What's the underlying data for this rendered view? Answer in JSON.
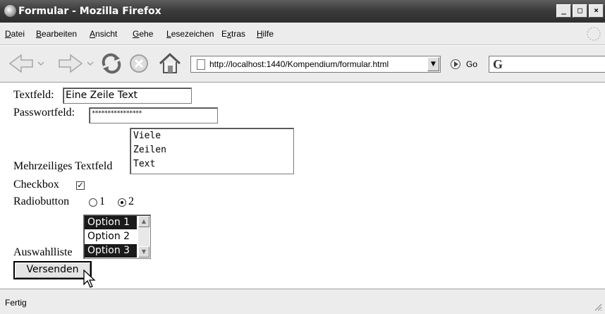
{
  "window": {
    "title": "Formular - Mozilla Firefox",
    "controls": [
      "_",
      "□",
      "×"
    ]
  },
  "menu": {
    "items": [
      {
        "label": "Datei"
      },
      {
        "label": "Bearbeiten"
      },
      {
        "label": "Ansicht"
      },
      {
        "label": "Gehe"
      },
      {
        "label": "Lesezeichen"
      },
      {
        "label": "Extras"
      },
      {
        "label": "Hilfe"
      }
    ]
  },
  "navbar": {
    "url": "http://localhost:1440/Kompendium/formular.html",
    "go_label": "Go",
    "search_engine_icon": "G",
    "icons": [
      "back-icon",
      "forward-icon",
      "reload-icon",
      "stop-icon",
      "home-icon"
    ]
  },
  "form": {
    "textfield": {
      "label": "Textfeld:",
      "value": "Eine Zeile Text"
    },
    "password": {
      "label": "Passwortfeld:",
      "value": "****************"
    },
    "textarea": {
      "label": "Mehrzeiliges Textfeld",
      "lines": [
        "Viele",
        "Zeilen",
        "Text"
      ]
    },
    "checkbox": {
      "label": "Checkbox",
      "checked": true,
      "mark": "✓"
    },
    "radio": {
      "label": "Radiobutton",
      "options": [
        {
          "label": "1",
          "checked": false
        },
        {
          "label": "2",
          "checked": true
        }
      ]
    },
    "select": {
      "label": "Auswahlliste",
      "options": [
        {
          "label": "Option 1",
          "selected": true
        },
        {
          "label": "Option 2",
          "selected": false
        },
        {
          "label": "Option 3",
          "selected": true
        }
      ]
    },
    "submit_label": "Versenden"
  },
  "status": {
    "text": "Fertig"
  }
}
